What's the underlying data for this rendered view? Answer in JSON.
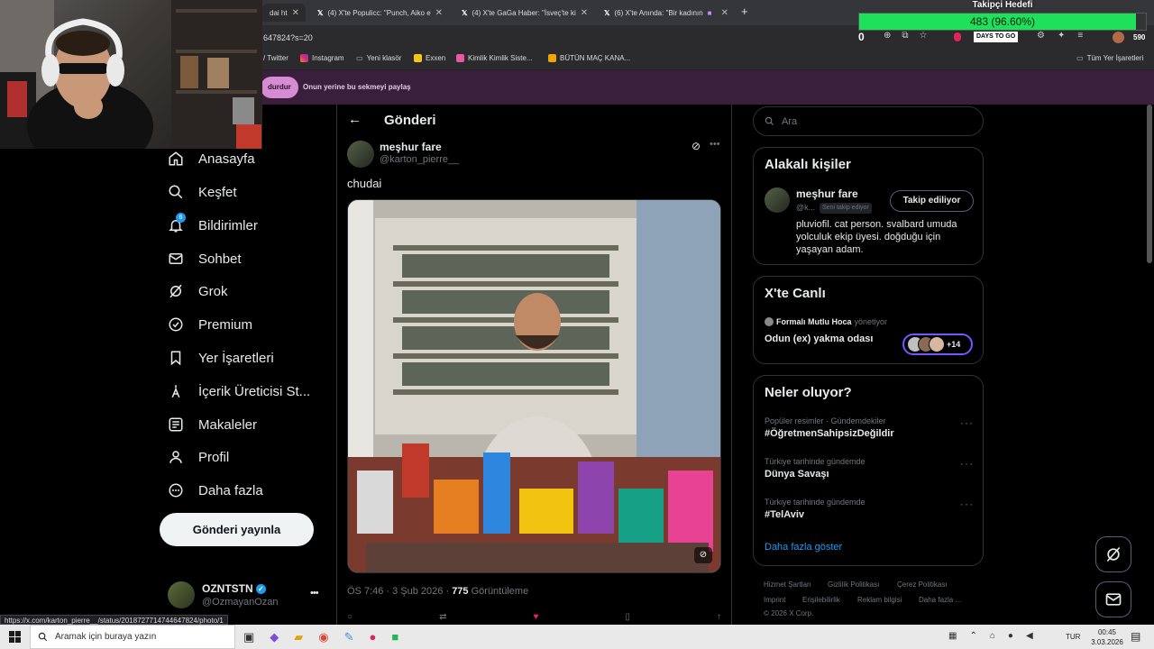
{
  "browser": {
    "tabs": [
      {
        "title": "dai ht"
      },
      {
        "title": "(4) X'te Populicc: \"Punch, Aiko e"
      },
      {
        "title": "(4) X'te GaGa Haber: \"İsveç'te ki"
      },
      {
        "title": "(6) X'te Anında: \"Bir kadının"
      }
    ],
    "new_tab_symbol": "+",
    "address": "647824?s=20",
    "counter_badge": "0",
    "profile_badge": "DAYS TO GO",
    "extension_count": "590",
    "bookmarks": [
      {
        "label": "/ Twitter"
      },
      {
        "label": "Instagram"
      },
      {
        "label": "Yeni klasör"
      },
      {
        "label": "Exxen"
      },
      {
        "label": "Kimlik Kimlik Siste..."
      },
      {
        "label": "BÜTÜN MAÇ KANA..."
      }
    ],
    "all_bookmarks": "Tüm Yer İşaretleri",
    "infobar": {
      "left_button": "durdur",
      "right_button": "Onun yerine bu sekmeyi paylaş"
    },
    "status_url": "https://x.com/karton_pierre__/status/2018727714744647824/photo/1"
  },
  "overlay": {
    "goal_title": "Takipçi Hedefi",
    "goal_text": "483 (96.60%)",
    "goal_progress": 0.966
  },
  "sidebar": {
    "items": [
      {
        "label": "Anasayfa",
        "icon": "home-icon"
      },
      {
        "label": "Keşfet",
        "icon": "search-icon"
      },
      {
        "label": "Bildirimler",
        "icon": "bell-icon",
        "badge": "6"
      },
      {
        "label": "Sohbet",
        "icon": "mail-icon"
      },
      {
        "label": "Grok",
        "icon": "grok-icon"
      },
      {
        "label": "Premium",
        "icon": "premium-icon"
      },
      {
        "label": "Yer İşaretleri",
        "icon": "bookmark-icon"
      },
      {
        "label": "İçerik Üreticisi St...",
        "icon": "creator-icon"
      },
      {
        "label": "Makaleler",
        "icon": "article-icon"
      },
      {
        "label": "Profil",
        "icon": "profile-icon"
      },
      {
        "label": "Daha fazla",
        "icon": "more-icon"
      }
    ],
    "post_button": "Gönderi yayınla",
    "account": {
      "name": "OZNTSTN",
      "handle": "@OzmayanOzan",
      "more": "•••"
    }
  },
  "main": {
    "header_title": "Gönderi",
    "post": {
      "author_name": "meşhur fare",
      "author_handle": "@karton_pierre__",
      "text": "chudai",
      "timestamp": "ÖS 7:46 · 3 Şub 2026 · ",
      "views_count": "775",
      "views_label": " Görüntüleme"
    }
  },
  "right": {
    "search_placeholder": "Ara",
    "related": {
      "title": "Alakalı kişiler",
      "name": "meşhur fare",
      "handle": "@k...",
      "follows_you": "Seni takip ediyor",
      "follow_button": "Takip ediliyor",
      "bio": "pluviofil. cat person. svalbard umuda yolculuk ekip üyesi. doğduğu için yaşayan adam."
    },
    "live": {
      "title": "X'te Canlı",
      "host": "Formalı Mutlu Hoca",
      "host_suffix": " yönetiyor",
      "space_title": "Odun (ex) yakma odası",
      "listeners_more": "+14"
    },
    "trends": {
      "title": "Neler oluyor?",
      "items": [
        {
          "category": "Popüler resimler · Gündemdekiler",
          "name": "#ÖğretmenSahipsizDeğildir"
        },
        {
          "category": "Türkiye tarihinde gündemde",
          "name": "Dünya Savaşı"
        },
        {
          "category": "Türkiye tarihinde gündemde",
          "name": "#TelAviv"
        }
      ],
      "show_more": "Daha fazla göster"
    },
    "footer": {
      "links": [
        "Hizmet Şartları",
        "Gizlilik Politikası",
        "Çerez Politikası",
        "Imprint",
        "Erişilebilirlik",
        "Reklam bilgisi",
        "Daha fazla ..."
      ],
      "copyright": "© 2026 X Corp."
    }
  },
  "taskbar": {
    "search_placeholder": "Aramak için buraya yazın",
    "language": "TUR",
    "time": "00:45",
    "date": "3.03.2026"
  },
  "colors": {
    "accent": "#1d9bf0",
    "goal_fill": "#1ee05a",
    "infobar_bg": "#3a1f3c"
  }
}
